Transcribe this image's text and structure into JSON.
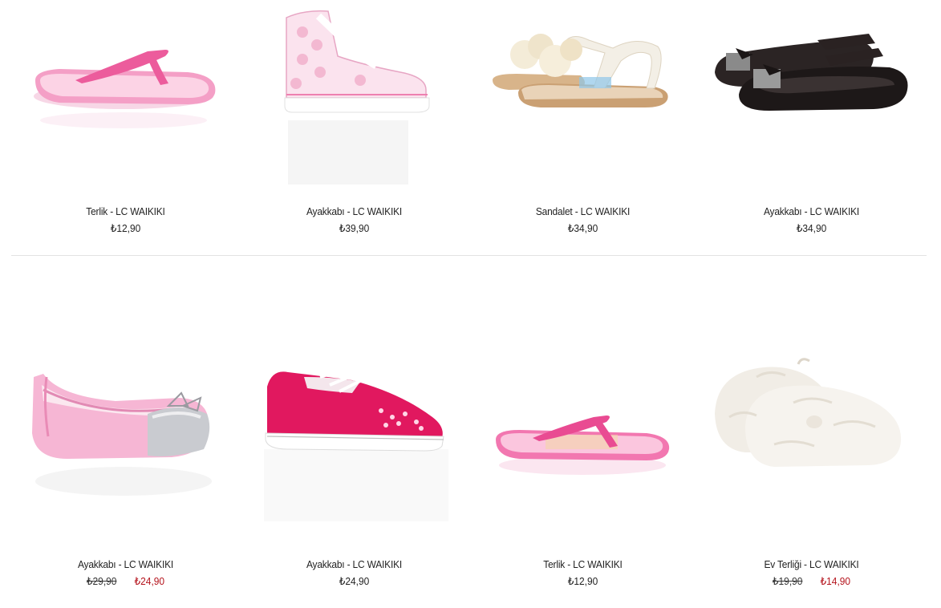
{
  "products": [
    {
      "title": "Terlik - LC WAIKIKI",
      "price": "₺12,90",
      "old_price": null,
      "image": "pink-flip-flop"
    },
    {
      "title": "Ayakkabı - LC WAIKIKI",
      "price": "₺39,90",
      "old_price": null,
      "image": "pink-lace-hightop-sneaker"
    },
    {
      "title": "Sandalet - LC WAIKIKI",
      "price": "₺34,90",
      "old_price": null,
      "image": "cream-flower-sandal"
    },
    {
      "title": "Ayakkabı - LC WAIKIKI",
      "price": "₺34,90",
      "old_price": null,
      "image": "black-bow-flat"
    },
    {
      "title": "Ayakkabı - LC WAIKIKI",
      "price": "₺24,90",
      "old_price": "₺29,90",
      "image": "pink-ballet-flat"
    },
    {
      "title": "Ayakkabı - LC WAIKIKI",
      "price": "₺24,90",
      "old_price": null,
      "image": "pink-canvas-sneaker"
    },
    {
      "title": "Terlik - LC WAIKIKI",
      "price": "₺12,90",
      "old_price": null,
      "image": "pink-flip-flop"
    },
    {
      "title": "Ev Terliği - LC WAIKIKI",
      "price": "₺14,90",
      "old_price": "₺19,90",
      "image": "white-fur-slipper"
    }
  ],
  "colors": {
    "sale": "#b4121b",
    "divider": "#e3e3e3"
  }
}
